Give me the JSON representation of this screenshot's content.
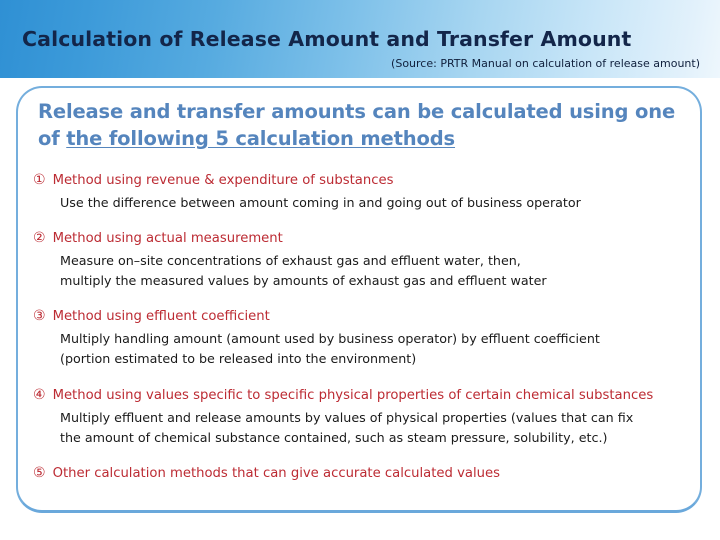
{
  "header": {
    "title": "Calculation of Release Amount and Transfer Amount",
    "source": "(Source: PRTR Manual on calculation of release amount)",
    "gradient_from": "#2f90d4",
    "gradient_to": "#eef7fd",
    "title_color": "#13264a"
  },
  "content": {
    "border_color": "#74aedd",
    "lead_color": "#5585bd",
    "method_title_color": "#bc2b33",
    "body_color": "#1a1a1a",
    "lead": {
      "line1": "Release and transfer amounts can be calculated using",
      "line2_plain": "one of ",
      "line2_underlined": "the following 5 calculation methods"
    },
    "methods": [
      {
        "number": "①",
        "title": "Method using revenue & expenditure of substances",
        "body_lines": [
          "Use the difference between amount coming in and going out of business operator"
        ]
      },
      {
        "number": "②",
        "title": "Method using actual measurement",
        "body_lines": [
          "Measure on–site concentrations of exhaust gas and effluent water, then,",
          "multiply the measured values by amounts of exhaust gas and effluent water"
        ]
      },
      {
        "number": "③",
        "title": "Method using effluent coefficient",
        "body_lines": [
          "Multiply handling amount (amount used by business operator) by effluent coefficient",
          "(portion estimated to be released into the environment)"
        ]
      },
      {
        "number": "④",
        "title": "Method using values specific to specific physical properties of certain chemical substances",
        "body_lines": [
          "Multiply effluent and release amounts by values of physical properties (values that can fix",
          "the amount of chemical substance contained, such as steam pressure, solubility, etc.)"
        ]
      },
      {
        "number": "⑤",
        "title": "Other calculation methods that can give accurate calculated values",
        "body_lines": []
      }
    ]
  }
}
